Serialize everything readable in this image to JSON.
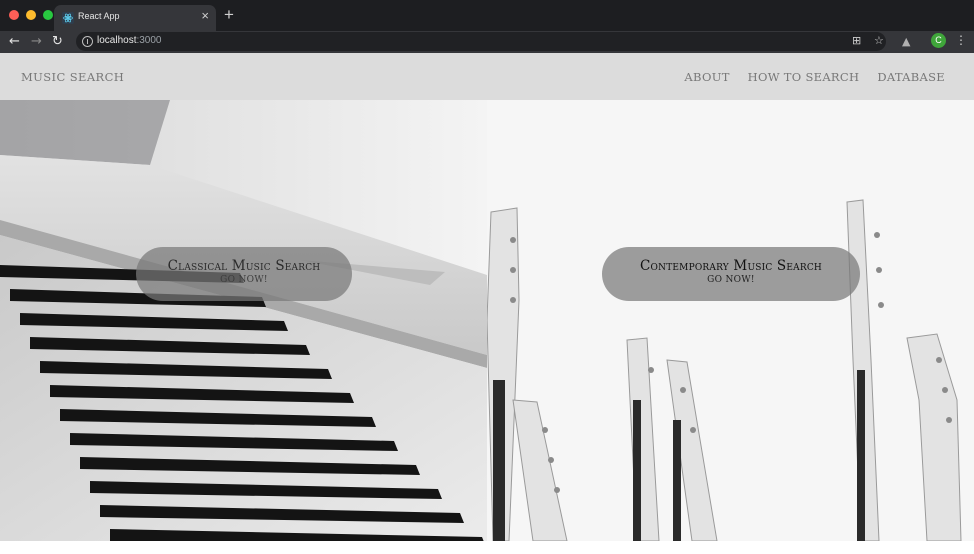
{
  "browser": {
    "tab_title": "React App",
    "tab_close": "×",
    "new_tab": "+",
    "url_host": "localhost",
    "url_port": ":3000",
    "avatar_letter": "C",
    "icons": [
      "back-icon",
      "forward-icon",
      "reload-icon",
      "info-icon",
      "translate-icon",
      "star-icon",
      "extension-icon",
      "menu-icon",
      "react-icon"
    ],
    "traffic_lights": {
      "close": "#ff5f57",
      "minimize": "#febc2e",
      "maximize": "#28c840"
    }
  },
  "site": {
    "brand": "MUSIC SEARCH",
    "nav": {
      "about": "ABOUT",
      "how_to_search": "HOW TO SEARCH",
      "database": "DATABASE"
    },
    "header_color": "#dcdcdc"
  },
  "hero": {
    "left": {
      "title": "Classical Music Search",
      "cta": "GO NOW!",
      "image": "piano-keys-photo"
    },
    "right": {
      "title": "Contemporary Music Search",
      "cta": "GO NOW!",
      "image": "guitar-necks-photo"
    }
  }
}
